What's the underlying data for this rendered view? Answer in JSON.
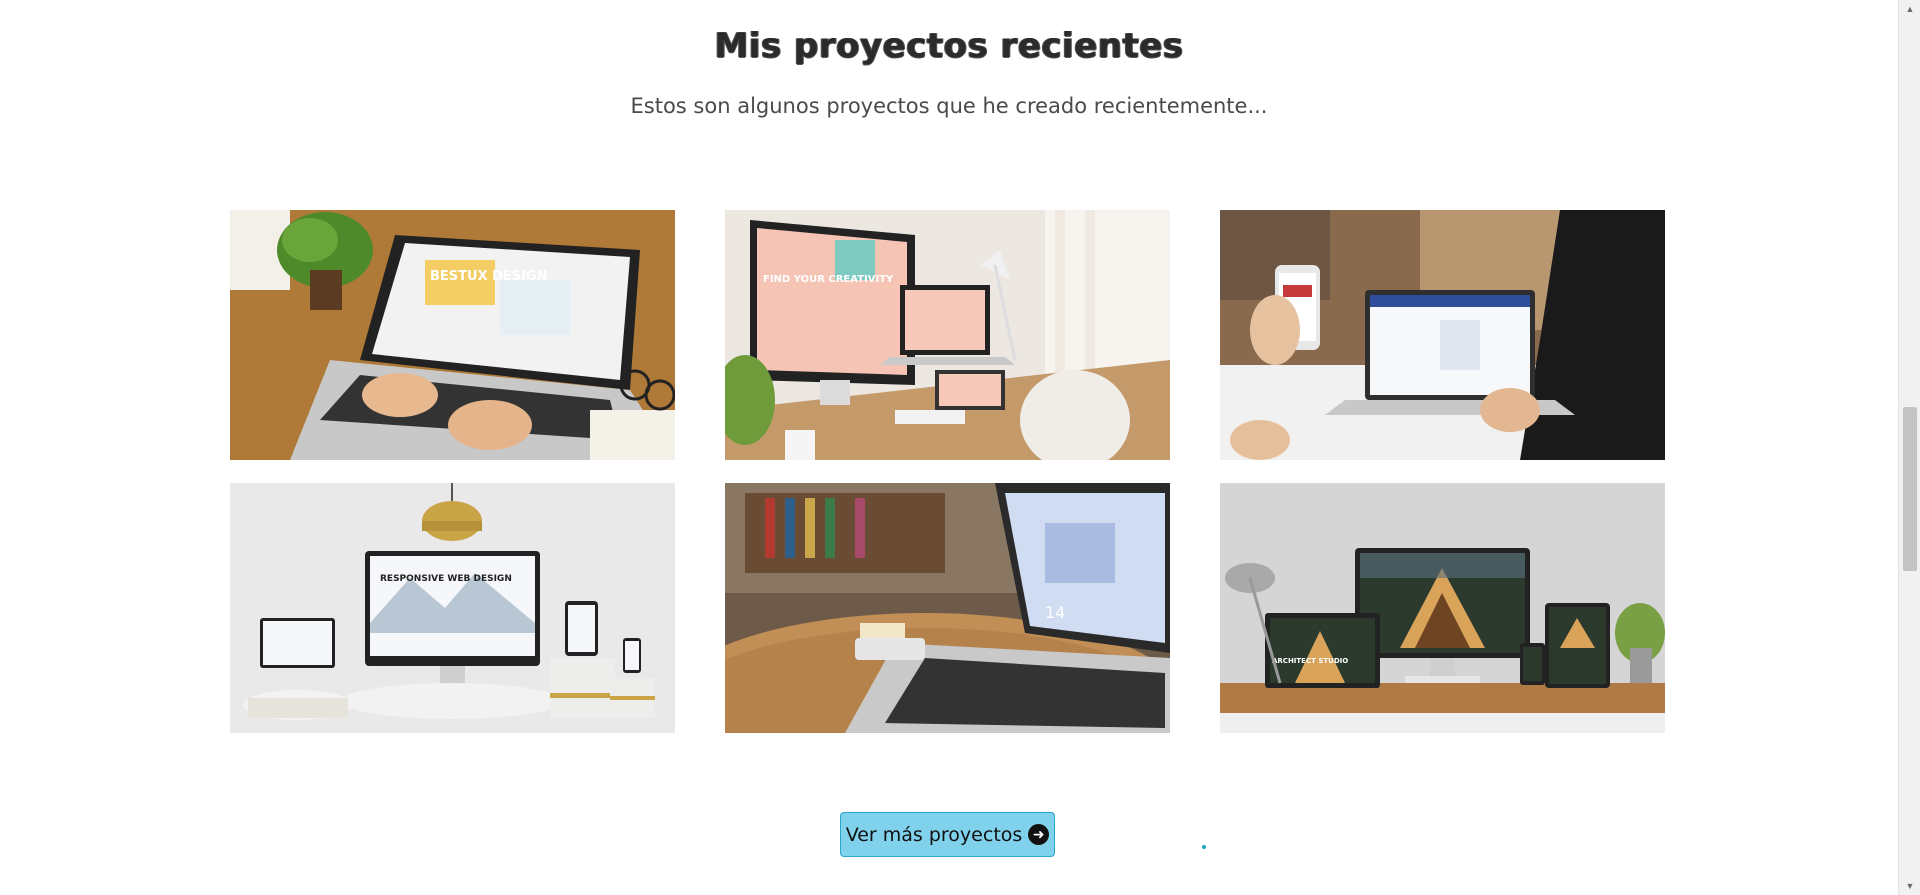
{
  "section": {
    "title": "Mis proyectos recientes",
    "subtitle": "Estos son algunos proyectos que he creado recientemente..."
  },
  "projects": [
    {
      "name": "laptop-bestux-design",
      "screen_text": "BESTUX DESIGN"
    },
    {
      "name": "imac-find-your-creativity",
      "screen_text": "FIND YOUR CREATIVITY"
    },
    {
      "name": "phone-and-laptop-app"
    },
    {
      "name": "responsive-web-design",
      "screen_text": "RESPONSIVE WEB DESIGN"
    },
    {
      "name": "laptop-coffee-table",
      "screen_text": "14"
    },
    {
      "name": "architect-studio",
      "screen_text": "ARCHITECT STUDIO"
    }
  ],
  "cta": {
    "label": "Ver más proyectos",
    "icon": "arrow-right-circle-icon"
  },
  "colors": {
    "button_bg": "#7fd1ec",
    "button_border": "#2aa6cc",
    "accent_dot": "#1aa9b8"
  }
}
